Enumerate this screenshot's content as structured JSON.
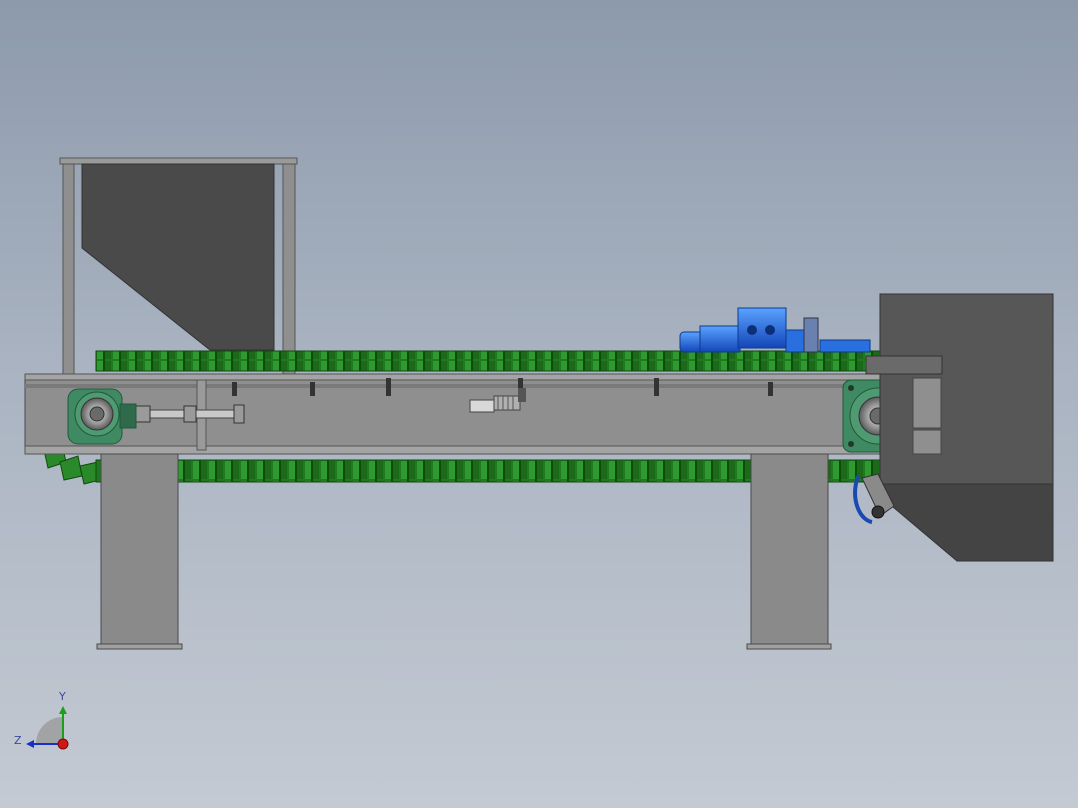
{
  "scene": {
    "model": "belt-conveyor-assembly",
    "view": "front"
  },
  "colors": {
    "frame": "#8f8f8f",
    "frame_dark": "#6e6e6e",
    "hopper": "#4c4c4c",
    "chain": "#1f7a1f",
    "chain_light": "#35a035",
    "bearing_housing": "#3f8a62",
    "motor": "#1a5fd6",
    "motor_light": "#3b86f0",
    "chute": "#525252",
    "axis_x": "#d01818",
    "axis_y": "#18a018",
    "axis_z": "#1830c8"
  },
  "triad": {
    "y_label": "Y",
    "z_label": "Z"
  }
}
